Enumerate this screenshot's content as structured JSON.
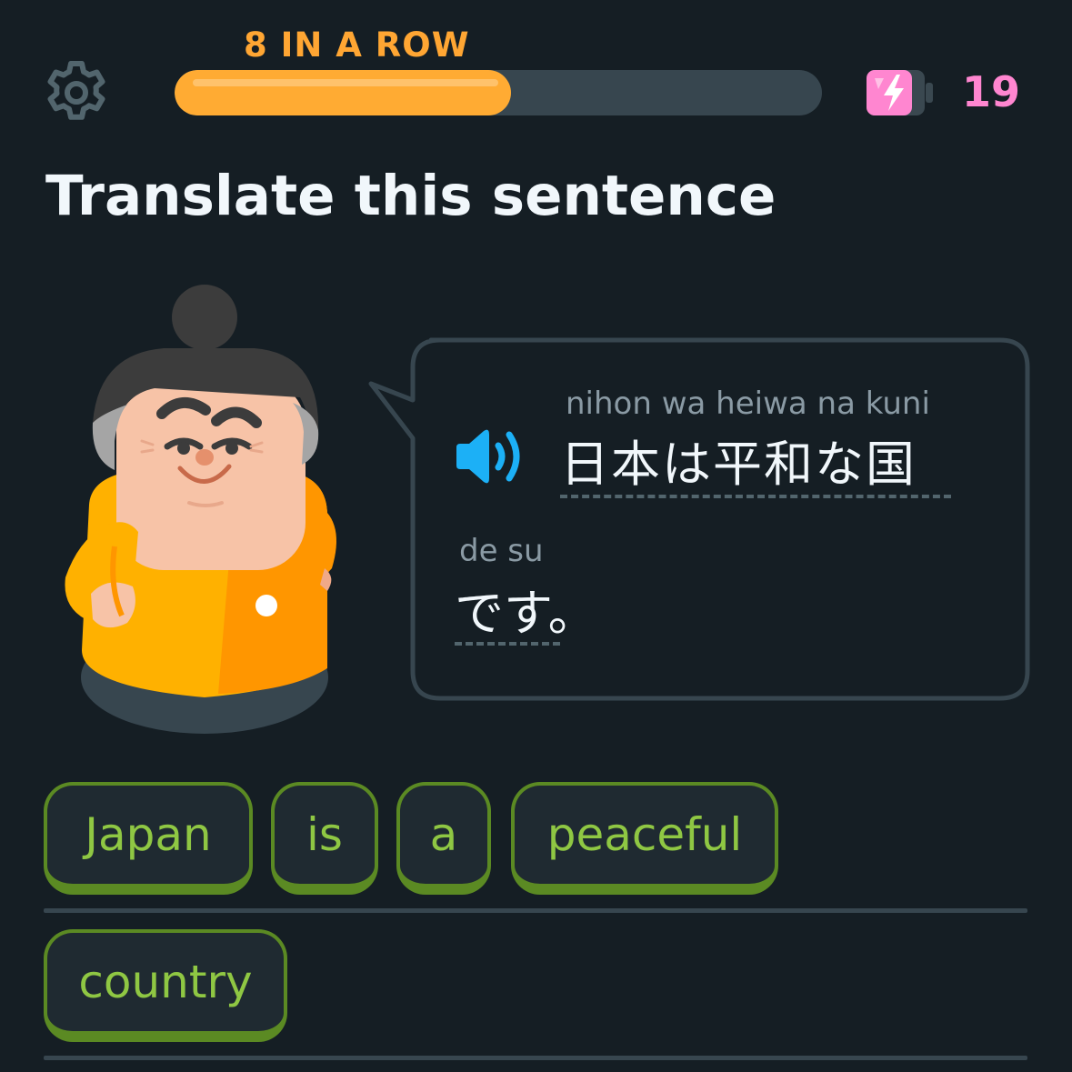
{
  "header": {
    "streak_label": "8 IN A ROW",
    "progress_fraction": 0.52,
    "energy_count": "19",
    "settings_icon": "gear-icon",
    "energy_icon": "battery-bolt-icon"
  },
  "prompt": {
    "title": "Translate this sentence"
  },
  "bubble": {
    "speaker_icon": "speaker-icon",
    "line1": {
      "romaji": "nihon  wa heiwa  na kuni",
      "japanese": "日本は平和な国"
    },
    "line2": {
      "romaji": "de  su",
      "japanese": "です。"
    }
  },
  "word_bank": {
    "tiles": [
      "Japan",
      "is",
      "a",
      "peaceful",
      "country"
    ]
  },
  "colors": {
    "background": "#151e24",
    "progress": "#ffab33",
    "streak_text": "#ffa633",
    "energy_text": "#ff86d0",
    "tile_text": "#8fc743",
    "tile_border": "#5b8a23",
    "speaker": "#1cb0f6"
  }
}
